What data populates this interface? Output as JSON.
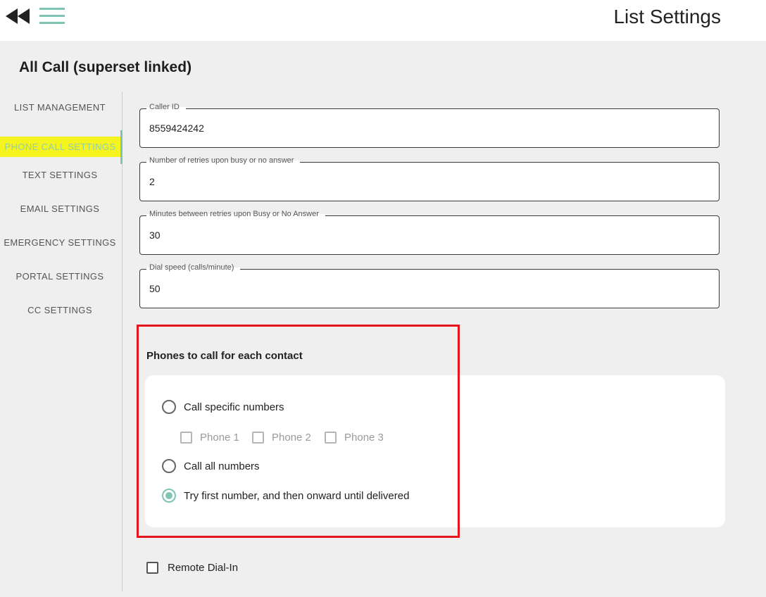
{
  "header": {
    "title": "List Settings",
    "back_icon": "double-chevron-left-icon",
    "menu_icon": "hamburger-menu-icon",
    "accent_color": "#7fc5b3"
  },
  "list": {
    "name": "All Call (superset linked)"
  },
  "sidebar": {
    "items": [
      {
        "label": "LIST MANAGEMENT"
      },
      {
        "label": "PHONE CALL SETTINGS",
        "active": true
      },
      {
        "label": "TEXT SETTINGS"
      },
      {
        "label": "EMAIL SETTINGS"
      },
      {
        "label": "EMERGENCY SETTINGS"
      },
      {
        "label": "PORTAL SETTINGS"
      },
      {
        "label": "CC SETTINGS"
      }
    ]
  },
  "fields": {
    "caller_id": {
      "label": "Caller ID",
      "value": "8559424242"
    },
    "retries": {
      "label": "Number of retries upon busy or no answer",
      "value": "2"
    },
    "retry_minutes": {
      "label": "Minutes between retries upon Busy or No Answer",
      "value": "30"
    },
    "dial_speed": {
      "label": "Dial speed (calls/minute)",
      "value": "50"
    }
  },
  "phones_to_call": {
    "heading": "Phones to call for each contact",
    "options": [
      {
        "label": "Call specific numbers",
        "checked": false
      },
      {
        "label": "Call all numbers",
        "checked": false
      },
      {
        "label": "Try first number, and then onward until delivered",
        "checked": true
      }
    ],
    "specific_phones": [
      {
        "label": "Phone 1",
        "checked": false
      },
      {
        "label": "Phone 2",
        "checked": false
      },
      {
        "label": "Phone 3",
        "checked": false
      }
    ]
  },
  "remote_dial_in": {
    "label": "Remote Dial-In",
    "checked": false
  },
  "annotation": {
    "highlight_color": "#e4161b",
    "nav_highlight_color": "#f6f41f"
  }
}
